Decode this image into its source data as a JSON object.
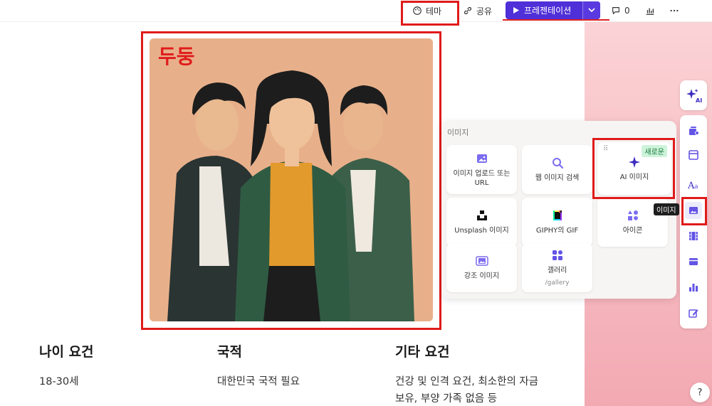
{
  "toolbar": {
    "theme_label": "테마",
    "share_label": "공유",
    "present_label": "프레젠테이션",
    "comment_count": "0"
  },
  "slide": {
    "image_caption": "두둥",
    "columns": [
      {
        "heading": "나이 요건",
        "text": "18-30세"
      },
      {
        "heading": "국적",
        "text": "대한민국 국적 필요"
      },
      {
        "heading": "기타 요건",
        "text": "건강 및 인격 요건, 최소한의 자금 보유, 부양 가족 없음 등"
      }
    ]
  },
  "image_panel": {
    "title": "이미지",
    "cards": [
      {
        "label": "이미지 업로드 또는 URL",
        "icon": "image-icon"
      },
      {
        "label": "웹 이미지 검색",
        "icon": "search-icon"
      },
      {
        "label": "AI 이미지",
        "icon": "sparkle-icon",
        "badge": "새로운"
      },
      {
        "label": "Unsplash 이미지",
        "icon": "unsplash-icon"
      },
      {
        "label": "GIPHY의 GIF",
        "icon": "giphy-icon"
      },
      {
        "label": "아이콘",
        "icon": "shapes-icon"
      },
      {
        "label": "강조 이미지",
        "icon": "accent-image-icon"
      },
      {
        "label": "갤러리",
        "sub": "/gallery",
        "icon": "gallery-icon"
      }
    ]
  },
  "rail": {
    "ai_label": "AI",
    "tooltip": "이미지",
    "help": "?"
  },
  "colors": {
    "accent": "#4f2fd8",
    "highlight": "#e01b1b",
    "pink": "#f6b9c0"
  }
}
